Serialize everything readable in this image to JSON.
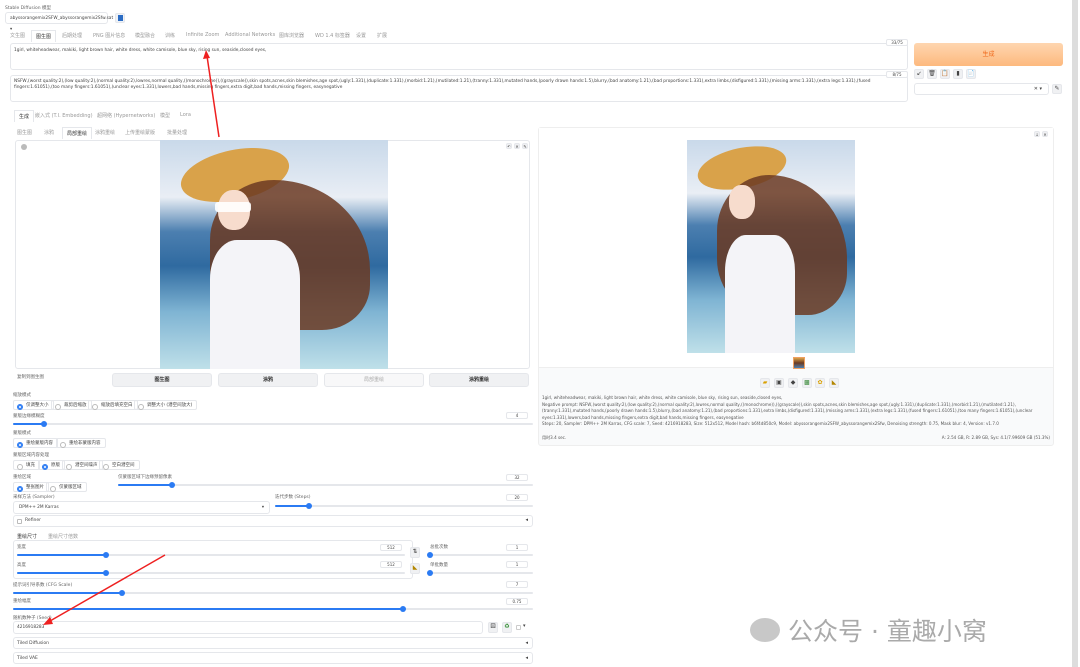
{
  "model": {
    "label": "Stable Diffusion 模型",
    "value": "abyssorangemix2SFW_abyssorangemix2Sfw.sat"
  },
  "top_tabs": [
    "文生图",
    "图生图",
    "后期处理",
    "PNG 图片信息",
    "模型融合",
    "训练",
    "Infinite Zoom",
    "Additional Networks",
    "图库浏览器",
    "WD 1.4 标签器",
    "设置",
    "扩展"
  ],
  "prompt": {
    "value": "1girl, whiteheadwear, makiki, light brown hair, white dress, white camisole, blue sky, rising sun, seaside,closed eyes,",
    "tokens": "33/75"
  },
  "negative_prompt": {
    "value": "NSFW,(worst quality:2),(low quality:2),(normal quality:2),lowres,normal quality,((monochrome)),((grayscale)),skin spots,acnes,skin blemishes,age spot,(ugly:1.331),(duplicate:1.331),(morbid:1.21),(mutilated:1.21),(tranny:1.331),mutated hands,(poorly drawn hands:1.5),blurry,(bad anatomy:1.21),(bad proportions:1.331),extra limbs,(disfigured:1.331),(missing arms:1.331),(extra legs:1.331),(fused fingers:1.61051),(too many fingers:1.61051),(unclear eyes:1.331),lowers,bad hands,missing fingers,extra digit,bad hands,missing fingers, easynegative",
    "tokens": "8/75"
  },
  "generate_label": "生成",
  "sub_tabs": [
    "生成",
    "嵌入式 (T.I. Embedding)",
    "超网络 (Hypernetworks)",
    "模型",
    "Lora"
  ],
  "mode_tabs": [
    "图生图",
    "涂鸦",
    "局部重绘",
    "涂鸦重绘",
    "上传重绘蒙版",
    "批量处理"
  ],
  "copy_to": {
    "label": "复制到图生图",
    "buttons": [
      "图生图",
      "涂鸦",
      "局部重绘",
      "涂鸦重绘"
    ]
  },
  "resize_mode": {
    "label": "缩放模式",
    "options": [
      "仅调整大小",
      "裁剪后缩放",
      "缩放后填充空白",
      "调整大小 (潜空间放大)"
    ]
  },
  "mask_blur": {
    "label": "蒙版边缘模糊度",
    "value": "4",
    "fraction": 0.06
  },
  "mask_mode": {
    "label": "蒙版模式",
    "options": [
      "重绘蒙版内容",
      "重绘非蒙版内容"
    ]
  },
  "masked_content": {
    "label": "蒙版区域内容处理",
    "options": [
      "填充",
      "原版",
      "潜空间噪声",
      "空白潜空间"
    ]
  },
  "inpaint_area": {
    "label": "重绘区域",
    "options": [
      "整张图片",
      "仅蒙版区域"
    ]
  },
  "padding": {
    "label": "仅蒙版区域下边缘预留像素",
    "value": "32",
    "fraction": 0.13
  },
  "sampler": {
    "label": "采样方法 (Sampler)",
    "value": "DPM++ 2M Karras"
  },
  "steps": {
    "label": "迭代步数 (Steps)",
    "value": "20",
    "fraction": 0.13
  },
  "refiner": "Refiner",
  "size_tabs": [
    "重绘尺寸",
    "重绘尺寸倍数"
  ],
  "width": {
    "label": "宽度",
    "value": "512",
    "fraction": 0.23
  },
  "height": {
    "label": "高度",
    "value": "512",
    "fraction": 0.23
  },
  "batch_count": {
    "label": "总批次数",
    "value": "1"
  },
  "batch_size": {
    "label": "单批数量",
    "value": "1"
  },
  "cfg": {
    "label": "提示词引导系数 (CFG Scale)",
    "value": "7",
    "fraction": 0.21
  },
  "denoise": {
    "label": "重绘幅度",
    "value": "0.75",
    "fraction": 0.75
  },
  "seed": {
    "label": "随机数种子 (Seed)",
    "value": "4216918283"
  },
  "accordions": [
    "Tiled Diffusion",
    "Tiled VAE"
  ],
  "output": {
    "info_prompt": "1girl, whiteheadwear, makiki, light brown hair, white dress, white camisole, blue sky, rising sun, seaside,closed eyes,",
    "info_negative": "Negative prompt: NSFW,(worst quality:2),(low quality:2),(normal quality:2),lowres,normal quality,((monochrome)),((grayscale)),skin spots,acnes,skin blemishes,age spot,(ugly:1.331),(duplicate:1.331),(morbid:1.21),(mutilated:1.21),(tranny:1.331),mutated hands,(poorly drawn hands:1.5),blurry,(bad anatomy:1.21),(bad proportions:1.331),extra limbs,(disfigured:1.331),(missing arms:1.331),(extra legs:1.331),(fused fingers:1.61051),(too many fingers:1.61051),(unclear eyes:1.331),lowers,bad hands,missing fingers,extra digit,bad hands,missing fingers, easynegative",
    "info_params": "Steps: 20, Sampler: DPM++ 2M Karras, CFG scale: 7, Seed: 4216918283, Size: 512x512, Model hash: b6f4d850c9, Model: abyssorangemix2SFW_abyssorangemix2Sfw, Denoising strength: 0.75, Mask blur: 4, Version: v1.7.0",
    "time": "用时3.4 sec.",
    "vram": "A: 2.54 GB, R: 2.89 GB, Sys: 4.1/7.99609 GB (51.3%)"
  },
  "watermark": "公众号 · 童趣小窝",
  "colors": {
    "accent": "#2b7bf3",
    "generate": "#fdbf8a",
    "generate_text": "#f06a1d",
    "arrow": "#ee2020"
  }
}
